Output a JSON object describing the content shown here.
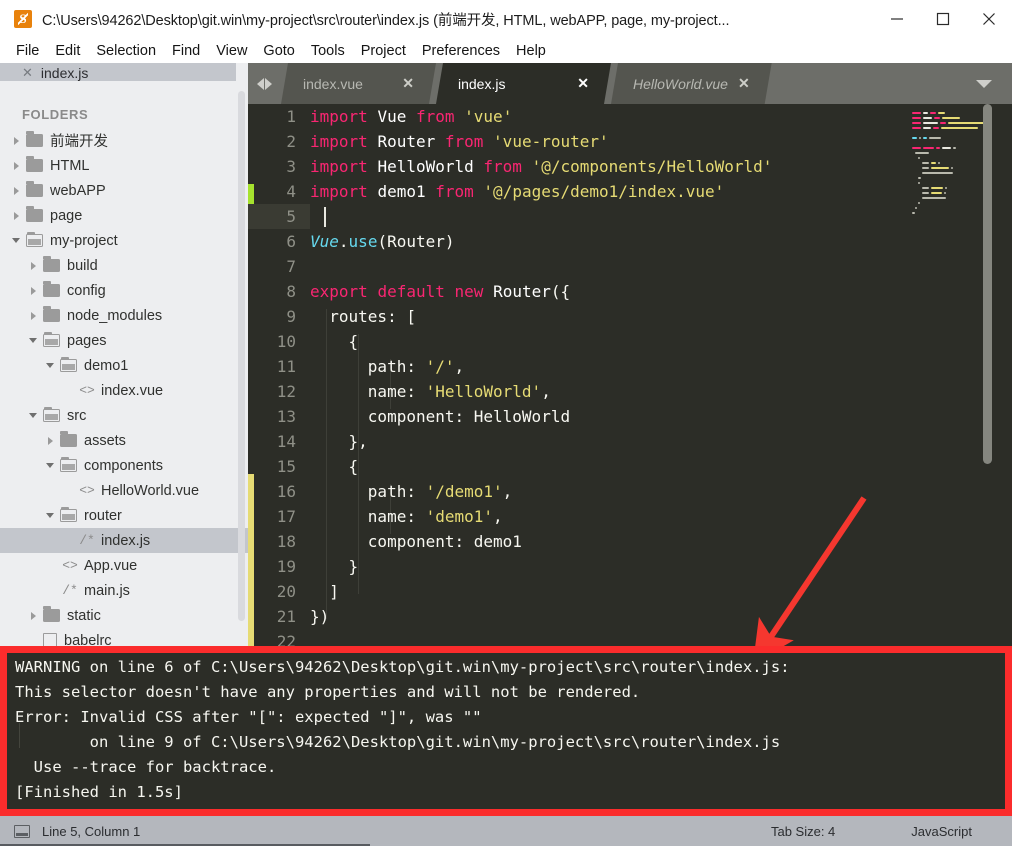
{
  "window": {
    "app_icon": "sublime-text-logo",
    "title": "C:\\Users\\94262\\Desktop\\git.win\\my-project\\src\\router\\index.js (前端开发, HTML, webAPP, page, my-project...",
    "minimize_label": "Minimize",
    "maximize_label": "Maximize",
    "close_label": "Close"
  },
  "menubar": {
    "items": [
      {
        "label": "File"
      },
      {
        "label": "Edit"
      },
      {
        "label": "Selection"
      },
      {
        "label": "Find"
      },
      {
        "label": "View"
      },
      {
        "label": "Goto"
      },
      {
        "label": "Tools"
      },
      {
        "label": "Project"
      },
      {
        "label": "Preferences"
      },
      {
        "label": "Help"
      }
    ]
  },
  "sidebar": {
    "open_file": {
      "label": "index.js",
      "close_icon": "close-icon"
    },
    "folders_header": "FOLDERS",
    "tree": [
      {
        "label": "前端开发",
        "depth": 0,
        "type": "folder",
        "state": "closed"
      },
      {
        "label": "HTML",
        "depth": 0,
        "type": "folder",
        "state": "closed"
      },
      {
        "label": "webAPP",
        "depth": 0,
        "type": "folder",
        "state": "closed"
      },
      {
        "label": "page",
        "depth": 0,
        "type": "folder",
        "state": "closed"
      },
      {
        "label": "my-project",
        "depth": 0,
        "type": "folder",
        "state": "open"
      },
      {
        "label": "build",
        "depth": 1,
        "type": "folder",
        "state": "closed"
      },
      {
        "label": "config",
        "depth": 1,
        "type": "folder",
        "state": "closed"
      },
      {
        "label": "node_modules",
        "depth": 1,
        "type": "folder",
        "state": "closed"
      },
      {
        "label": "pages",
        "depth": 1,
        "type": "folder",
        "state": "open"
      },
      {
        "label": "demo1",
        "depth": 2,
        "type": "folder",
        "state": "open"
      },
      {
        "label": "index.vue",
        "depth": 3,
        "type": "vue",
        "state": "none"
      },
      {
        "label": "src",
        "depth": 1,
        "type": "folder",
        "state": "open"
      },
      {
        "label": "assets",
        "depth": 2,
        "type": "folder",
        "state": "closed"
      },
      {
        "label": "components",
        "depth": 2,
        "type": "folder",
        "state": "open"
      },
      {
        "label": "HelloWorld.vue",
        "depth": 3,
        "type": "vue",
        "state": "none"
      },
      {
        "label": "router",
        "depth": 2,
        "type": "folder",
        "state": "open"
      },
      {
        "label": "index.js",
        "depth": 3,
        "type": "js",
        "state": "none",
        "selected": true
      },
      {
        "label": "App.vue",
        "depth": 2,
        "type": "vue",
        "state": "none"
      },
      {
        "label": "main.js",
        "depth": 2,
        "type": "js",
        "state": "none"
      },
      {
        "label": "static",
        "depth": 1,
        "type": "folder",
        "state": "closed"
      },
      {
        "label": "babelrc",
        "depth": 1,
        "type": "file",
        "state": "none"
      }
    ]
  },
  "tabs": {
    "prev_icon": "chevron-left-icon",
    "next_icon": "chevron-right-icon",
    "dropdown_icon": "chevron-down-icon",
    "items": [
      {
        "label": "index.vue",
        "active": false,
        "italic": false,
        "close_icon": "close-icon"
      },
      {
        "label": "index.js",
        "active": true,
        "italic": false,
        "close_icon": "close-icon"
      },
      {
        "label": "HelloWorld.vue",
        "active": false,
        "italic": true,
        "close_icon": "close-icon"
      }
    ]
  },
  "editor": {
    "language": "JavaScript",
    "active_line": 5,
    "lines": [
      {
        "n": "1",
        "tokens": [
          {
            "t": "import",
            "c": "kw"
          },
          {
            "t": " ",
            "c": "pln"
          },
          {
            "t": "Vue",
            "c": "cls"
          },
          {
            "t": " ",
            "c": "pln"
          },
          {
            "t": "from",
            "c": "kw"
          },
          {
            "t": " ",
            "c": "pln"
          },
          {
            "t": "'vue'",
            "c": "str"
          }
        ]
      },
      {
        "n": "2",
        "tokens": [
          {
            "t": "import",
            "c": "kw"
          },
          {
            "t": " ",
            "c": "pln"
          },
          {
            "t": "Router",
            "c": "cls"
          },
          {
            "t": " ",
            "c": "pln"
          },
          {
            "t": "from",
            "c": "kw"
          },
          {
            "t": " ",
            "c": "pln"
          },
          {
            "t": "'vue-router'",
            "c": "str"
          }
        ]
      },
      {
        "n": "3",
        "tokens": [
          {
            "t": "import",
            "c": "kw"
          },
          {
            "t": " ",
            "c": "pln"
          },
          {
            "t": "HelloWorld",
            "c": "cls"
          },
          {
            "t": " ",
            "c": "pln"
          },
          {
            "t": "from",
            "c": "kw"
          },
          {
            "t": " ",
            "c": "pln"
          },
          {
            "t": "'@/components/HelloWorld'",
            "c": "str"
          }
        ]
      },
      {
        "n": "4",
        "tokens": [
          {
            "t": "import",
            "c": "kw"
          },
          {
            "t": " ",
            "c": "pln"
          },
          {
            "t": "demo1",
            "c": "cls"
          },
          {
            "t": " ",
            "c": "pln"
          },
          {
            "t": "from",
            "c": "kw"
          },
          {
            "t": " ",
            "c": "pln"
          },
          {
            "t": "'@/pages/demo1/index.vue'",
            "c": "str"
          }
        ]
      },
      {
        "n": "5",
        "tokens": []
      },
      {
        "n": "6",
        "tokens": [
          {
            "t": "Vue",
            "c": "ital"
          },
          {
            "t": ".",
            "c": "pln"
          },
          {
            "t": "use",
            "c": "fn"
          },
          {
            "t": "(Router)",
            "c": "pln"
          }
        ]
      },
      {
        "n": "7",
        "tokens": []
      },
      {
        "n": "8",
        "tokens": [
          {
            "t": "export",
            "c": "kw"
          },
          {
            "t": " ",
            "c": "pln"
          },
          {
            "t": "default",
            "c": "kw"
          },
          {
            "t": " ",
            "c": "pln"
          },
          {
            "t": "new",
            "c": "kw"
          },
          {
            "t": " ",
            "c": "pln"
          },
          {
            "t": "Router",
            "c": "cls"
          },
          {
            "t": "({",
            "c": "pln"
          }
        ]
      },
      {
        "n": "9",
        "tokens": [
          {
            "t": "  routes: [",
            "c": "pln"
          }
        ]
      },
      {
        "n": "10",
        "tokens": [
          {
            "t": "    {",
            "c": "pln"
          }
        ]
      },
      {
        "n": "11",
        "tokens": [
          {
            "t": "      path: ",
            "c": "pln"
          },
          {
            "t": "'/'",
            "c": "str"
          },
          {
            "t": ",",
            "c": "pln"
          }
        ]
      },
      {
        "n": "12",
        "tokens": [
          {
            "t": "      name: ",
            "c": "pln"
          },
          {
            "t": "'HelloWorld'",
            "c": "str"
          },
          {
            "t": ",",
            "c": "pln"
          }
        ]
      },
      {
        "n": "13",
        "tokens": [
          {
            "t": "      component: HelloWorld",
            "c": "pln"
          }
        ]
      },
      {
        "n": "14",
        "tokens": [
          {
            "t": "    },",
            "c": "pln"
          }
        ]
      },
      {
        "n": "15",
        "tokens": [
          {
            "t": "    {",
            "c": "pln"
          }
        ]
      },
      {
        "n": "16",
        "tokens": [
          {
            "t": "      path: ",
            "c": "pln"
          },
          {
            "t": "'/demo1'",
            "c": "str"
          },
          {
            "t": ",",
            "c": "pln"
          }
        ]
      },
      {
        "n": "17",
        "tokens": [
          {
            "t": "      name: ",
            "c": "pln"
          },
          {
            "t": "'demo1'",
            "c": "str"
          },
          {
            "t": ",",
            "c": "pln"
          }
        ]
      },
      {
        "n": "18",
        "tokens": [
          {
            "t": "      component: demo1",
            "c": "pln"
          }
        ]
      },
      {
        "n": "19",
        "tokens": [
          {
            "t": "    }",
            "c": "pln"
          }
        ]
      },
      {
        "n": "20",
        "tokens": [
          {
            "t": "  ]",
            "c": "pln"
          }
        ]
      },
      {
        "n": "21",
        "tokens": [
          {
            "t": "})",
            "c": "pln"
          }
        ]
      },
      {
        "n": "22",
        "tokens": []
      }
    ]
  },
  "console": {
    "lines": [
      "WARNING on line 6 of C:\\Users\\94262\\Desktop\\git.win\\my-project\\src\\router\\index.js:",
      "This selector doesn't have any properties and will not be rendered.",
      "Error: Invalid CSS after \"[\": expected \"]\", was \"\"",
      "        on line 9 of C:\\Users\\94262\\Desktop\\git.win\\my-project\\src\\router\\index.js",
      "  Use --trace for backtrace.",
      "[Finished in 1.5s]"
    ],
    "highlight_color": "#fb2c2c"
  },
  "annotation": {
    "arrow_color": "#f5372f",
    "arrow_icon": "arrow-pointer-annotation"
  },
  "statusbar": {
    "icon": "layout-icon",
    "cursor_position": "Line 5, Column 1",
    "tab_size": "Tab Size: 4",
    "syntax": "JavaScript"
  }
}
